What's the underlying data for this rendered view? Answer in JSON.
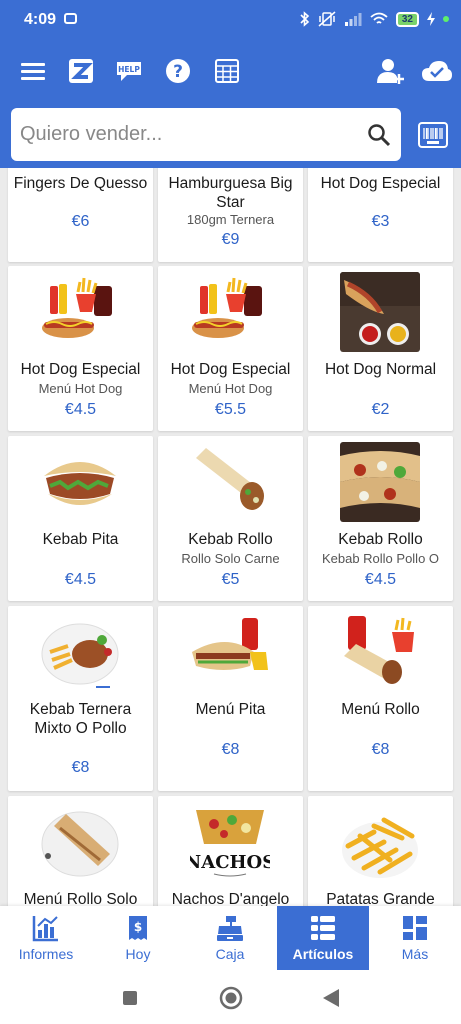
{
  "status": {
    "time": "4:09",
    "battery": "32"
  },
  "toolbar": {
    "icons": [
      "menu-icon",
      "zettle-logo-icon",
      "help-chat-icon",
      "question-icon",
      "grid-layout-icon",
      "add-user-icon",
      "cloud-sync-icon"
    ],
    "help_badge": "HELP"
  },
  "search": {
    "placeholder": "Quiero vender..."
  },
  "products": [
    {
      "name": "Fingers De Quesso",
      "sub": "",
      "price": "€6"
    },
    {
      "name": "Hamburguesa Big Star",
      "sub": "180gm Ternera",
      "price": "€9"
    },
    {
      "name": "Hot Dog Especial",
      "sub": "",
      "price": "€3"
    },
    {
      "name": "Hot Dog Especial",
      "sub": "Menú Hot Dog",
      "price": "€4.5"
    },
    {
      "name": "Hot Dog Especial",
      "sub": "Menú Hot Dog",
      "price": "€5.5"
    },
    {
      "name": "Hot Dog Normal",
      "sub": "",
      "price": "€2"
    },
    {
      "name": "Kebab Pita",
      "sub": "",
      "price": "€4.5"
    },
    {
      "name": "Kebab Rollo",
      "sub": "Rollo Solo Carne",
      "price": "€5"
    },
    {
      "name": "Kebab Rollo",
      "sub": "Kebab Rollo Pollo O",
      "price": "€4.5"
    },
    {
      "name": "Kebab Ternera Mixto O Pollo",
      "sub": "",
      "price": "€8"
    },
    {
      "name": "Menú Pita",
      "sub": "",
      "price": "€8"
    },
    {
      "name": "Menú Rollo",
      "sub": "",
      "price": "€8"
    },
    {
      "name": "Menú Rollo Solo",
      "sub": "",
      "price": ""
    },
    {
      "name": "Nachos D'angelo",
      "sub": "",
      "price": ""
    },
    {
      "name": "Patatas Grande",
      "sub": "",
      "price": ""
    }
  ],
  "nachos_logo": "NACHOS",
  "nav": [
    {
      "label": "Informes",
      "icon": "chart-icon"
    },
    {
      "label": "Hoy",
      "icon": "receipt-icon"
    },
    {
      "label": "Caja",
      "icon": "cash-register-icon"
    },
    {
      "label": "Artículos",
      "icon": "item-list-icon",
      "active": true
    },
    {
      "label": "Más",
      "icon": "more-grid-icon"
    }
  ],
  "colors": {
    "primary": "#3b6ed3",
    "price": "#2f63c8",
    "background": "#ebebeb"
  }
}
